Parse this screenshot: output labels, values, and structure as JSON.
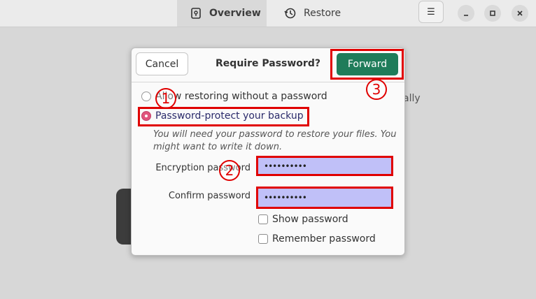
{
  "header": {
    "tabs": [
      {
        "label": "Overview",
        "icon": "safe-icon",
        "active": true
      },
      {
        "label": "Restore",
        "icon": "history-icon",
        "active": false
      }
    ],
    "menu_icon": "hamburger-menu-icon",
    "window_controls": [
      "minimize-icon",
      "maximize-icon",
      "close-icon"
    ]
  },
  "background": {
    "partial_text": "ally"
  },
  "dialog": {
    "title": "Require Password?",
    "cancel_label": "Cancel",
    "forward_label": "Forward",
    "options": [
      {
        "label": "Allow restoring without a password",
        "selected": false
      },
      {
        "label": "Password-protect your backup",
        "selected": true
      }
    ],
    "hint": "You will need your password to restore your files. You might want to write it down.",
    "encryption_label": "Encryption password",
    "encryption_value": "••••••••••",
    "confirm_label": "Confirm password",
    "confirm_value": "••••••••••",
    "show_password_label": "Show password",
    "show_password_checked": false,
    "remember_password_label": "Remember password",
    "remember_password_checked": false
  },
  "annotations": {
    "marker_1": "1",
    "marker_2": "2",
    "marker_3": "3",
    "color": "#e00000",
    "field_highlight_color": "#c0c0f8"
  },
  "colors": {
    "accent_button": "#1f7c5a",
    "radio_selected": "#e0557d"
  }
}
